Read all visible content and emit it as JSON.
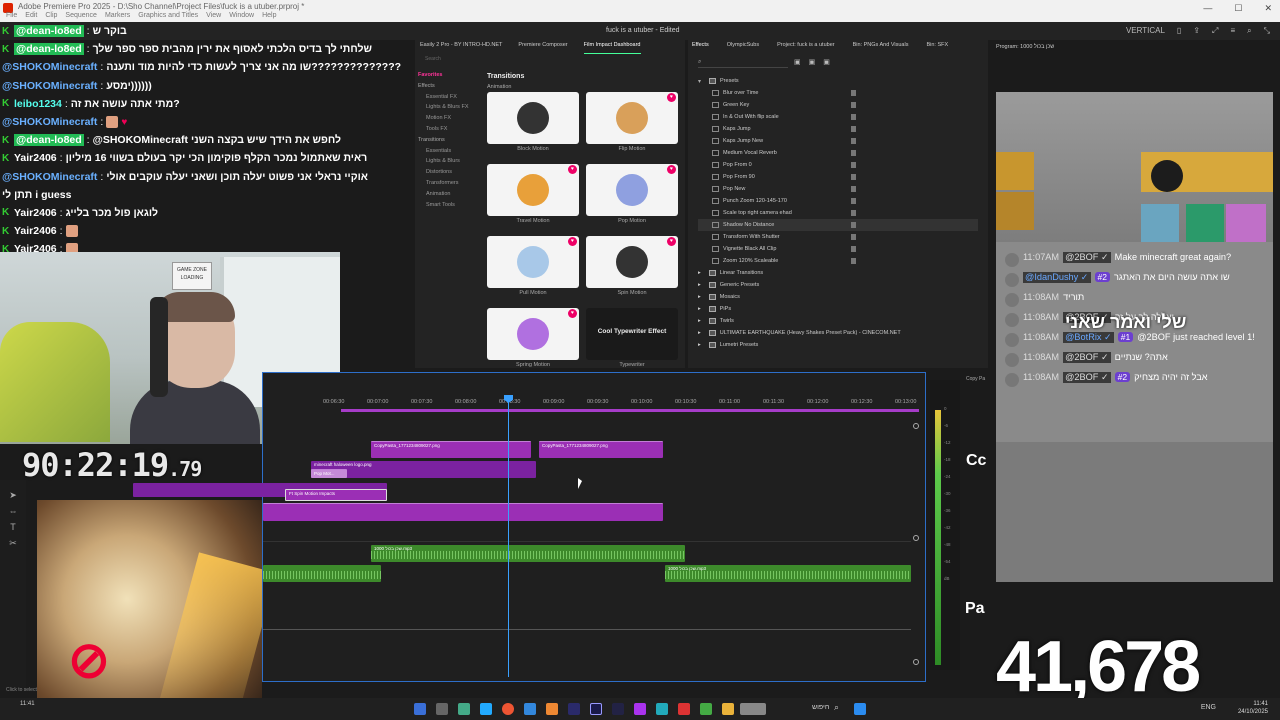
{
  "window": {
    "app_title": "Adobe Premiere Pro 2025 - D:\\Sho Channel\\Project Files\\fuck is a utuber.prproj *",
    "menu": [
      "File",
      "Edit",
      "Clip",
      "Sequence",
      "Markers",
      "Graphics and Titles",
      "View",
      "Window",
      "Help"
    ],
    "project_title": "fuck is a utuber - Edited",
    "workspace": "VERTICAL"
  },
  "chat": [
    {
      "user": "@dean-lo8ed",
      "msg": "בוקר ש",
      "badge": true
    },
    {
      "user": "@dean-lo8ed",
      "msg": "שלחתי לך בדיס הלכתי לאסוף את ירין מהבית ספר ספר שלך",
      "badge": true
    },
    {
      "user": "@SHOKOMinecraft",
      "msg": "שו מה אני צריך לעשות כדי להיות מוד ותענה??????????????",
      "badge": false
    },
    {
      "user": "@SHOKOMinecraft",
      "msg": "ימסע))))))",
      "badge": false
    },
    {
      "user": "leibo1234",
      "msg": "מתי אתה עושה את זה?",
      "badge": true
    },
    {
      "user": "@SHOKOMinecraft",
      "msg": "",
      "badge": false,
      "emote": true
    },
    {
      "user": "@dean-lo8ed",
      "msg": "@SHOKOMinecraft לחפש את הידך שיש בקצה השני",
      "badge": true
    },
    {
      "user": "Yair2406",
      "msg": "ראית שאתמול נמכר הקלף פוקימון הכי יקר בעולם בשווי 16 מיליון",
      "badge": true
    },
    {
      "user": "@SHOKOMinecraft",
      "msg": "אוקיי נראלי אני פשוט יעלה תוכן ושאני יעלה עוקבים אולי",
      "badge": false
    },
    {
      "user": "",
      "msg": "תתן לי i guess",
      "badge": false
    },
    {
      "user": "Yair2406",
      "msg": "לוגאן פול מכר בלייג",
      "badge": true
    },
    {
      "user": "Yair2406",
      "msg": "",
      "badge": true,
      "emote": true
    },
    {
      "user": "Yair2406",
      "msg": "",
      "badge": true,
      "emote": true
    }
  ],
  "webcam": {
    "sign_text": "GAME ZONE LOADING"
  },
  "timer": {
    "main": "90:22:19",
    "ms": ".79"
  },
  "fx_browser": {
    "tabs": [
      "Easily 2 Pro - BY INTRO-HD.NET",
      "Premiere Composer",
      "Film Impact Dashboard"
    ],
    "active_tab": 2,
    "search_placeholder": "Search",
    "side": [
      {
        "label": "Favorites",
        "type": "hdr"
      },
      {
        "label": "Effects",
        "type": "top"
      },
      {
        "label": "Essential FX",
        "type": "sub"
      },
      {
        "label": "Lights & Blurs FX",
        "type": "sub"
      },
      {
        "label": "Motion FX",
        "type": "sub"
      },
      {
        "label": "Tools FX",
        "type": "sub"
      },
      {
        "label": "Transitions",
        "type": "top"
      },
      {
        "label": "Essentials",
        "type": "sub"
      },
      {
        "label": "Lights & Blurs",
        "type": "sub"
      },
      {
        "label": "Distortions",
        "type": "sub"
      },
      {
        "label": "Transformers",
        "type": "sub"
      },
      {
        "label": "Animation",
        "type": "sub"
      },
      {
        "label": "Smart Tools",
        "type": "sub"
      }
    ],
    "section_title": "Transitions",
    "section_sub": "Animation",
    "cards": [
      {
        "label": "Block Motion",
        "color": "#333333"
      },
      {
        "label": "Flip Motion",
        "color": "#d9a05a"
      },
      {
        "label": "Travel Motion",
        "color": "#e8a03a"
      },
      {
        "label": "Pop Motion",
        "color": "#8fa0e0"
      },
      {
        "label": "Pull Motion",
        "color": "#a8c8e8"
      },
      {
        "label": "Spin Motion",
        "color": "#333333"
      },
      {
        "label": "Spring Motion",
        "color": "#b070e0"
      },
      {
        "label": "Typewriter",
        "color": "#1a1a1a",
        "dark_text": "Cool Typewriter Effect"
      }
    ]
  },
  "effects": {
    "tabs": [
      "Effects",
      "OlympicSubs",
      "Project: fuck is a utuber",
      "Bin: PNGs And Visuals",
      "Bin: SFX"
    ],
    "active_tab": 0,
    "presets_label": "Presets",
    "items": [
      {
        "label": "Blur over Time",
        "folder": false
      },
      {
        "label": "Green Key",
        "folder": false
      },
      {
        "label": "In & Out With flip scale",
        "folder": false
      },
      {
        "label": "Kaps Jump",
        "folder": false
      },
      {
        "label": "Kaps Jump New",
        "folder": false
      },
      {
        "label": "Medium Vocal Reverb",
        "folder": false
      },
      {
        "label": "Pop From 0",
        "folder": false
      },
      {
        "label": "Pop From 90",
        "folder": false
      },
      {
        "label": "Pop New",
        "folder": false
      },
      {
        "label": "Punch Zoom 120-145-170",
        "folder": false
      },
      {
        "label": "Scale top right camera ehad",
        "folder": false
      },
      {
        "label": "Shadow No Distance",
        "folder": false,
        "selected": true
      },
      {
        "label": "Transform With Shutter",
        "folder": false
      },
      {
        "label": "Vignette Black All Clip",
        "folder": false
      },
      {
        "label": "Zoom 120% Scaleable",
        "folder": false
      },
      {
        "label": "Linear Transitions",
        "folder": true
      },
      {
        "label": "Generic Presets",
        "folder": true
      },
      {
        "label": "Mosaics",
        "folder": true
      },
      {
        "label": "PiPs",
        "folder": true
      },
      {
        "label": "Twirls",
        "folder": true
      },
      {
        "label": "ULTIMATE EARTHQUAKE (Heavy Shakes Preset Pack) - CINECOM.NET",
        "folder": true
      },
      {
        "label": "Lumetri Presets",
        "folder": true
      }
    ]
  },
  "program": {
    "title": "Program: 1000 שכן בכול"
  },
  "chat2": [
    {
      "time": "11:07AM",
      "user": "@2BOF",
      "verified": true,
      "badge": "",
      "msg": "Make minecraft great again?"
    },
    {
      "time": "",
      "user": "@IdanDushy",
      "verified": true,
      "badge": "#2",
      "msg": "שו אתה עושה היום את האתגר"
    },
    {
      "time": "11:08AM",
      "user": "",
      "verified": false,
      "badge": "",
      "msg": "תוריד"
    },
    {
      "time": "11:08AM",
      "user": "@2BOF",
      "verified": true,
      "badge": "",
      "msg": "יאללה לך על זה"
    },
    {
      "time": "11:08AM",
      "user": "@BotRix",
      "verified": true,
      "badge": "#1",
      "msg": "@2BOF just reached level 1!"
    },
    {
      "time": "11:08AM",
      "user": "@2BOF",
      "verified": true,
      "badge": "",
      "msg": "אתה? שנתיים"
    },
    {
      "time": "11:08AM",
      "user": "@2BOF",
      "verified": true,
      "badge": "#2",
      "msg": "אבל זה יהיה מצחיק"
    }
  ],
  "chat2_overlay": "שלי ואמר שאני",
  "timeline": {
    "ruler": [
      "00:06:30",
      "00:07:00",
      "00:07:30",
      "00:08:00",
      "00:08:30",
      "00:09:00",
      "00:09:30",
      "00:10:00",
      "00:10:30",
      "00:11:00",
      "00:11:30",
      "00:12:00",
      "00:12:30",
      "00:13:00"
    ],
    "clips": {
      "v1": "CopyPasta_1771234809027.png",
      "v2": "CopyPasta_1771234809027.png",
      "v3": "minecraft haloween logo.png",
      "v4": "Pop Mot...",
      "v5": "Ft Spin Motion Impacts",
      "a1": "1000 שכן בכול.mp3",
      "a2": "1000 שכן בכול.mp3"
    }
  },
  "side_labels": {
    "cc": "Cc",
    "pa": "Pa",
    "copy": "Copy Pa"
  },
  "counter": "41,678",
  "taskbar": {
    "time": "11:41",
    "date": "24/10/2025",
    "lang": "ENG",
    "search": "חיפוש",
    "click_to_select": "Click to select"
  }
}
